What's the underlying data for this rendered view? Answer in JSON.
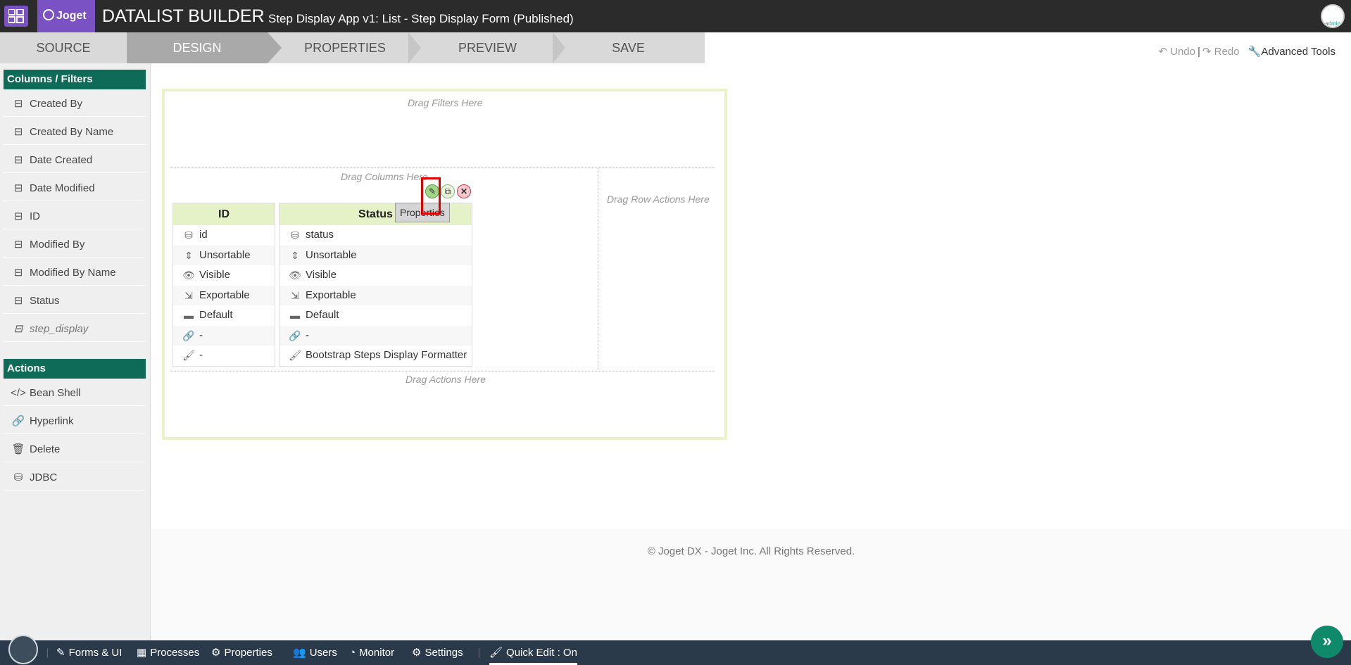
{
  "header": {
    "logo_text": "Joget",
    "title": "DATALIST BUILDER",
    "subtitle": "Step Display App v1: List - Step Display Form (Published)",
    "avatar_label": "admin"
  },
  "steps": [
    {
      "label": "SOURCE"
    },
    {
      "label": "DESIGN"
    },
    {
      "label": "PROPERTIES"
    },
    {
      "label": "PREVIEW"
    },
    {
      "label": "SAVE"
    }
  ],
  "toolbar": {
    "undo": "Undo",
    "redo": "Redo",
    "advanced": "Advanced Tools"
  },
  "palette": {
    "columns_header": "Columns / Filters",
    "columns": [
      {
        "label": "Created By",
        "icon": "column-icon"
      },
      {
        "label": "Created By Name",
        "icon": "column-icon"
      },
      {
        "label": "Date Created",
        "icon": "column-icon"
      },
      {
        "label": "Date Modified",
        "icon": "column-icon"
      },
      {
        "label": "ID",
        "icon": "column-icon"
      },
      {
        "label": "Modified By",
        "icon": "column-icon"
      },
      {
        "label": "Modified By Name",
        "icon": "column-icon"
      },
      {
        "label": "Status",
        "icon": "column-icon"
      },
      {
        "label": "step_display",
        "icon": "column-icon"
      }
    ],
    "actions_header": "Actions",
    "actions": [
      {
        "label": "Bean Shell",
        "icon": "code-icon"
      },
      {
        "label": "Hyperlink",
        "icon": "link-icon"
      },
      {
        "label": "Delete",
        "icon": "trash-icon"
      },
      {
        "label": "JDBC",
        "icon": "database-icon"
      }
    ]
  },
  "canvas": {
    "drag_filters": "Drag Filters Here",
    "drag_columns": "Drag Columns Here",
    "drag_row_actions": "Drag Row Actions Here",
    "drag_actions": "Drag Actions Here",
    "properties_tooltip": "Properties",
    "columns": [
      {
        "header": "ID",
        "rows": [
          "id",
          "Unsortable",
          "Visible",
          "Exportable",
          "Default",
          "-",
          "-"
        ]
      },
      {
        "header": "Status",
        "rows": [
          "status",
          "Unsortable",
          "Visible",
          "Exportable",
          "Default",
          "-",
          "Bootstrap Steps Display Formatter"
        ]
      }
    ]
  },
  "footer": {
    "copyright": "© Joget DX - Joget Inc. All Rights Reserved."
  },
  "bottombar": {
    "items": [
      {
        "label": "Forms & UI",
        "icon": "edit-icon"
      },
      {
        "label": "Processes",
        "icon": "table-icon"
      },
      {
        "label": "Properties",
        "icon": "gear-icon"
      },
      {
        "label": "Users",
        "icon": "users-icon"
      },
      {
        "label": "Monitor",
        "icon": "dashboard-icon"
      },
      {
        "label": "Settings",
        "icon": "gears-icon"
      },
      {
        "label": "Quick Edit : On",
        "icon": "brush-icon"
      }
    ]
  },
  "colors": {
    "accent_purple": "#7b52c4",
    "palette_header_green": "#0e6b57",
    "column_header_green": "#e5f2c8",
    "bottombar": "#2b3a4a",
    "highlight_red": "#e00000"
  }
}
